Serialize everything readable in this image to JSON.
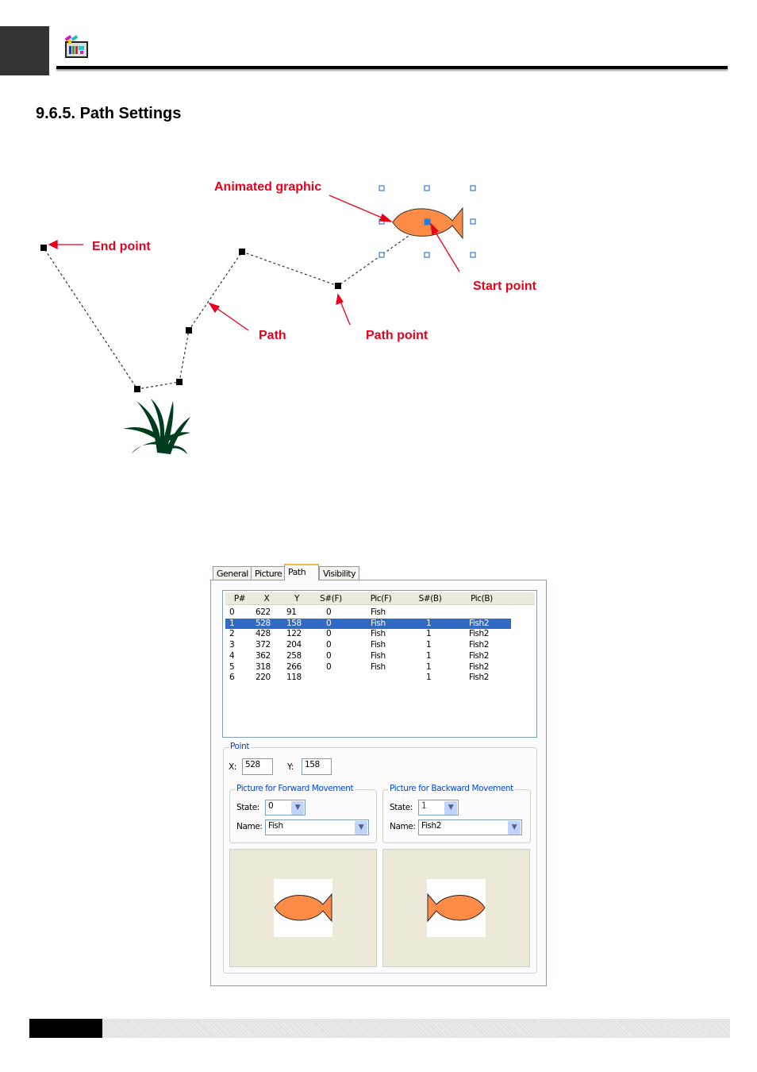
{
  "header": {
    "icon": "palette-screen-icon"
  },
  "section_title": "9.6.5. Path Settings",
  "diagram": {
    "labels": {
      "animated_graphic": "Animated graphic",
      "end_point": "End point",
      "start_point": "Start point",
      "path": "Path",
      "path_point": "Path point"
    },
    "colors": {
      "label": "#e8001c",
      "fish": "#ff8c46",
      "plant": "#003c1e",
      "handle": "#3c78d8"
    }
  },
  "dialog": {
    "tabs": [
      {
        "label": "General"
      },
      {
        "label": "Picture"
      },
      {
        "label": "Path",
        "active": true
      },
      {
        "label": "Visibility"
      }
    ],
    "table": {
      "columns": [
        "P#",
        "X",
        "Y",
        "S#(F)",
        "Pic(F)",
        "S#(B)",
        "Pic(B)"
      ],
      "rows": [
        [
          "0",
          "622",
          "91",
          "0",
          "Fish",
          "",
          ""
        ],
        [
          "1",
          "528",
          "158",
          "0",
          "Fish",
          "1",
          "Fish2"
        ],
        [
          "2",
          "428",
          "122",
          "0",
          "Fish",
          "1",
          "Fish2"
        ],
        [
          "3",
          "372",
          "204",
          "0",
          "Fish",
          "1",
          "Fish2"
        ],
        [
          "4",
          "362",
          "258",
          "0",
          "Fish",
          "1",
          "Fish2"
        ],
        [
          "5",
          "318",
          "266",
          "0",
          "Fish",
          "1",
          "Fish2"
        ],
        [
          "6",
          "220",
          "118",
          "",
          "",
          "1",
          "Fish2"
        ]
      ],
      "selected_row": 1
    },
    "point": {
      "legend": "Point",
      "x_label": "X:",
      "x_value": "528",
      "y_label": "Y:",
      "y_value": "158"
    },
    "forward": {
      "legend": "Picture for Forward Movement",
      "state_label": "State:",
      "state_value": "0",
      "name_label": "Name:",
      "name_value": "Fish"
    },
    "backward": {
      "legend": "Picture for Backward Movement",
      "state_label": "State:",
      "state_value": "1",
      "name_label": "Name:",
      "name_value": "Fish2"
    }
  }
}
